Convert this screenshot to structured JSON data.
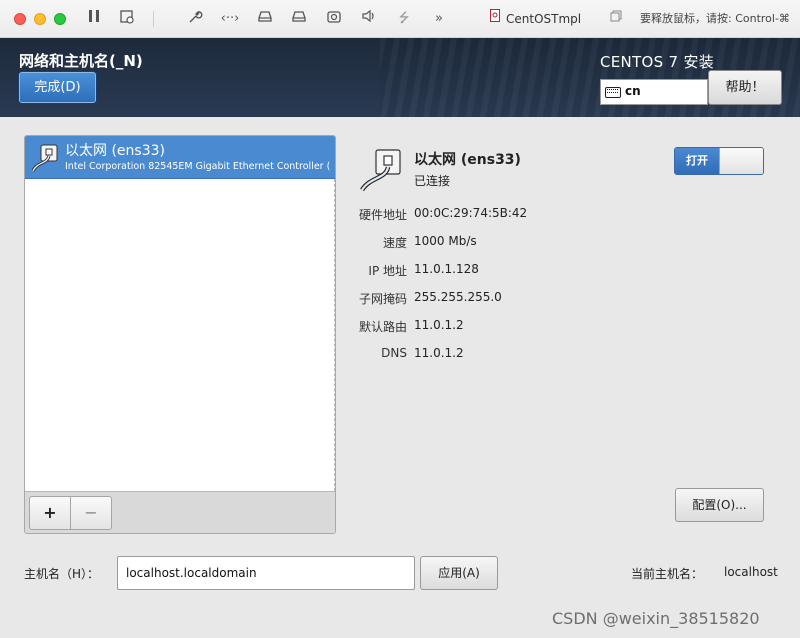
{
  "window": {
    "title": "CentOSTmpl",
    "hint": "要释放鼠标，请按: Control-⌘"
  },
  "header": {
    "title": "网络和主机名(_N)",
    "done_label": "完成(D)",
    "product": "CENTOS 7 安装",
    "keyboard_layout": "cn",
    "help_label": "帮助！"
  },
  "devices": [
    {
      "name": "以太网 (ens33)",
      "description": "Intel Corporation 82545EM Gigabit Ethernet Controller ("
    }
  ],
  "list_toolbar": {
    "add_label": "+",
    "remove_label": "−"
  },
  "detail": {
    "name": "以太网 (ens33)",
    "status": "已连接",
    "toggle_label": "打开",
    "properties": [
      {
        "label": "硬件地址",
        "value": "00:0C:29:74:5B:42"
      },
      {
        "label": "速度",
        "value": "1000 Mb/s"
      },
      {
        "label": "IP 地址",
        "value": "11.0.1.128"
      },
      {
        "label": "子网掩码",
        "value": "255.255.255.0"
      },
      {
        "label": "默认路由",
        "value": "11.0.1.2"
      },
      {
        "label": "DNS",
        "value": "11.0.1.2"
      }
    ],
    "config_label": "配置(O)..."
  },
  "hostname": {
    "label": "主机名（H）：",
    "value": "localhost.localdomain",
    "apply_label": "应用(A)",
    "current_label": "当前主机名：",
    "current_value": "localhost"
  },
  "watermark": "CSDN @weixin_38515820"
}
